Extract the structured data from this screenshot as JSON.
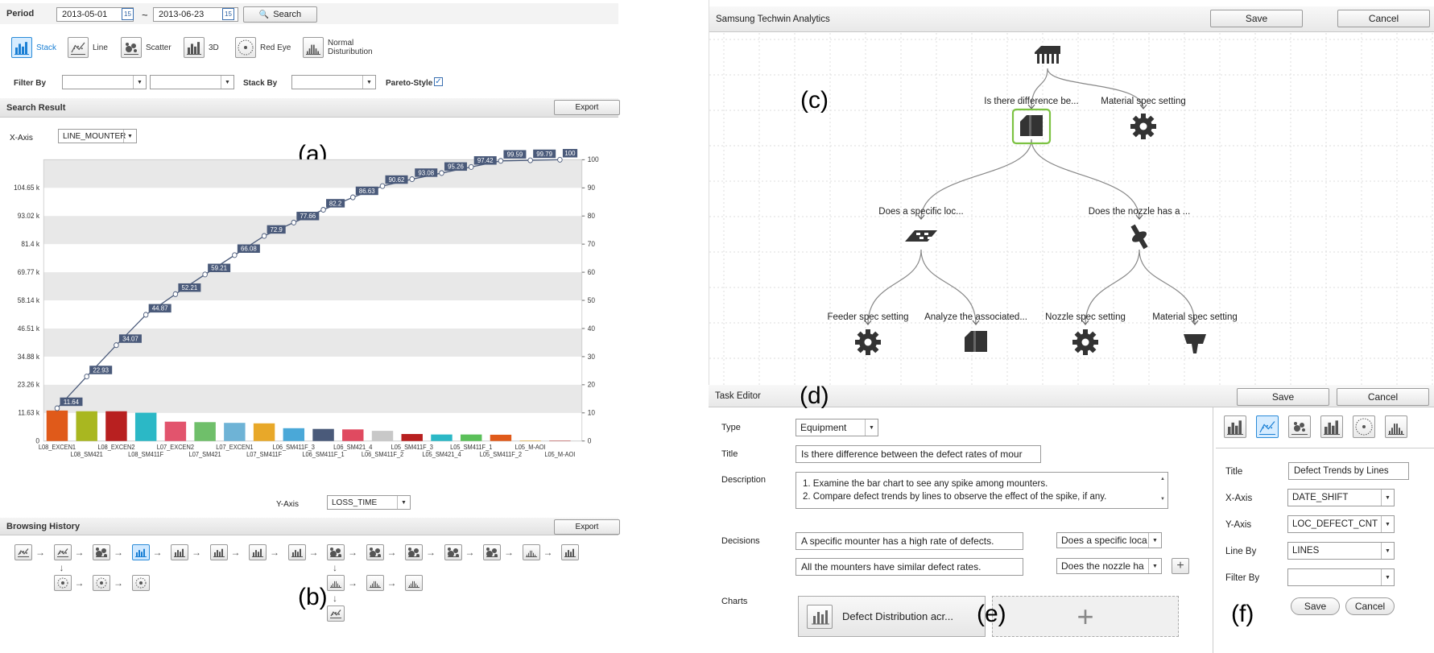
{
  "left": {
    "period_label": "Period",
    "date_start": "2013-05-01",
    "date_sep": "~",
    "date_end": "2013-06-23",
    "calendar_day": "15",
    "search_label": "Search",
    "chart_types": [
      {
        "label": "Stack",
        "icon": "stack-bar-icon",
        "selected": true
      },
      {
        "label": "Line",
        "icon": "line-chart-icon",
        "selected": false
      },
      {
        "label": "Scatter",
        "icon": "scatter-icon",
        "selected": false
      },
      {
        "label": "3D",
        "icon": "bar-3d-icon",
        "selected": false
      },
      {
        "label": "Red Eye",
        "icon": "red-eye-icon",
        "selected": false
      },
      {
        "label": "Normal\nDisturibution",
        "icon": "normal-distribution-icon",
        "selected": false
      }
    ],
    "filter_by_label": "Filter By",
    "stack_by_label": "Stack By",
    "pareto_label": "Pareto-Style",
    "pareto_checked": true,
    "search_result_title": "Search Result",
    "export_label": "Export",
    "xaxis_label": "X-Axis",
    "xaxis_value": "LINE_MOUNTER",
    "yaxis_label": "Y-Axis",
    "yaxis_value": "LOSS_TIME",
    "caption_a": "(a)",
    "browsing_history_title": "Browsing History",
    "history_export_label": "Export",
    "caption_b": "(b)"
  },
  "chart_data": {
    "type": "bar",
    "subtype": "pareto",
    "categories": [
      "L08_EXCEN1",
      "L08_SM421",
      "L08_EXCEN2",
      "L08_SM411F",
      "L07_EXCEN2",
      "L07_SM421",
      "L07_EXCEN1",
      "L07_SM411F",
      "L06_SM411F_3",
      "L06_SM411F_1",
      "L06_SM421_4",
      "L06_SM411F_2",
      "L05_SM411F_3",
      "L05_SM421_4",
      "L05_SM411F_1",
      "L05_SM411F_2",
      "L05_M-AOI",
      "L05_M-AOI"
    ],
    "values": [
      12600,
      12300,
      12300,
      11700,
      8000,
      7800,
      7500,
      7300,
      5300,
      5000,
      4800,
      4200,
      2900,
      2700,
      2700,
      2600,
      200,
      150
    ],
    "bar_colors": [
      "#e05a1a",
      "#a9b720",
      "#b82020",
      "#2bb8c6",
      "#e2546d",
      "#6fbf6a",
      "#6eb3d6",
      "#e8a829",
      "#4aa8d8",
      "#4a5a7a",
      "#e04a60",
      "#c8c8c8",
      "#b82020",
      "#2bb8c6",
      "#5bc05a",
      "#e05a1a",
      "#e8a829",
      "#b82020"
    ],
    "cumulative_percent": [
      11.64,
      22.93,
      34.07,
      44.87,
      52.21,
      59.21,
      66.08,
      72.9,
      77.66,
      82.2,
      86.63,
      90.62,
      93.08,
      95.26,
      97.42,
      99.59,
      99.79,
      100
    ],
    "y_ticks": [
      "0",
      "11.63 k",
      "23.26 k",
      "34.88 k",
      "46.51 k",
      "58.14 k",
      "69.77 k",
      "81.4 k",
      "93.02 k",
      "104.65 k"
    ],
    "y2_ticks": [
      "0",
      "10",
      "20",
      "30",
      "40",
      "50",
      "60",
      "70",
      "80",
      "90",
      "100"
    ],
    "ylim": [
      0,
      116280
    ],
    "y2lim": [
      0,
      100
    ]
  },
  "tree": {
    "app_title": "Samsung Techwin Analytics",
    "save_label": "Save",
    "cancel_label": "Cancel",
    "caption_c": "(c)",
    "nodes": [
      {
        "label": "Is there difference be...",
        "icon": "mounter-icon"
      },
      {
        "label": "Material spec setting",
        "icon": "gear-icon"
      },
      {
        "label": "Does a specific loc...",
        "icon": "feeder-plate-icon"
      },
      {
        "label": "Does the nozzle has a ...",
        "icon": "nozzle-icon"
      },
      {
        "label": "Feeder spec setting",
        "icon": "gear-icon"
      },
      {
        "label": "Analyze the associated...",
        "icon": "mounter-icon"
      },
      {
        "label": "Nozzle spec setting",
        "icon": "gear-icon"
      },
      {
        "label": "Material spec setting",
        "icon": "material-icon"
      }
    ]
  },
  "task_editor": {
    "title": "Task Editor",
    "caption_d": "(d)",
    "save_label": "Save",
    "cancel_label": "Cancel",
    "type_label": "Type",
    "type_value": "Equipment",
    "title_label": "Title",
    "title_value": "Is there difference between the defect rates of mour",
    "description_label": "Description",
    "description_line1": "1. Examine the bar chart to see any spike among mounters.",
    "description_line2": "2. Compare defect trends by lines to observe the effect of the spike, if any.",
    "decisions_label": "Decisions",
    "decision1_text": "A specific mounter has a high rate of defects.",
    "decision1_target": "Does a specific loca",
    "decision2_text": "All the mounters have similar defect rates.",
    "decision2_target": "Does the nozzle ha",
    "add_symbol": "+",
    "charts_label": "Charts",
    "chart_card_label": "Defect Distribution acr...",
    "caption_e": "(e)",
    "caption_f": "(f)"
  },
  "chart_editor": {
    "title_label": "Title",
    "title_value": "Defect Trends by Lines",
    "xaxis_label": "X-Axis",
    "xaxis_value": "DATE_SHIFT",
    "yaxis_label": "Y-Axis",
    "yaxis_value": "LOC_DEFECT_CNT",
    "lineby_label": "Line By",
    "lineby_value": "LINES",
    "filterby_label": "Filter By",
    "save_label": "Save",
    "cancel_label": "Cancel"
  },
  "colors": {
    "accent": "#2a8bd8",
    "selected_node_border": "#7cc242",
    "line_series": "#4a5a7a"
  }
}
